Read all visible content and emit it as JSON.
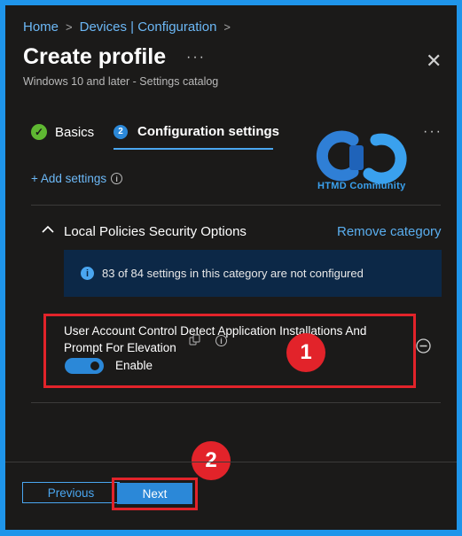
{
  "breadcrumb": {
    "items": [
      "Home",
      "Devices | Configuration"
    ]
  },
  "header": {
    "title": "Create profile",
    "more": "···",
    "subtitle": "Windows 10 and later - Settings catalog",
    "close": "✕"
  },
  "tabs": [
    {
      "label": "Basics",
      "state": "completed"
    },
    {
      "label": "Configuration settings",
      "step": "2",
      "state": "active"
    }
  ],
  "tabs_more": "···",
  "logo": {
    "text": "HTMD Community"
  },
  "add_settings": {
    "label": "+ Add settings",
    "info": "i"
  },
  "category": {
    "title": "Local Policies Security Options",
    "remove_label": "Remove category",
    "banner": {
      "info": "i",
      "text": "83 of 84 settings in this category are not configured"
    }
  },
  "setting": {
    "name": "User Account Control Detect Application Installations And Prompt For Elevation",
    "info": "i",
    "toggle_on": true,
    "toggle_label": "Enable"
  },
  "annotations": {
    "badge1": "1",
    "badge2": "2"
  },
  "footer": {
    "previous_label": "Previous",
    "next_label": "Next"
  },
  "colors": {
    "accent": "#2b88d8",
    "link": "#6cb8f6",
    "success": "#5fb832",
    "highlight": "#e2232a",
    "banner_bg": "#0c2847",
    "page_bg": "#1b1a19"
  }
}
